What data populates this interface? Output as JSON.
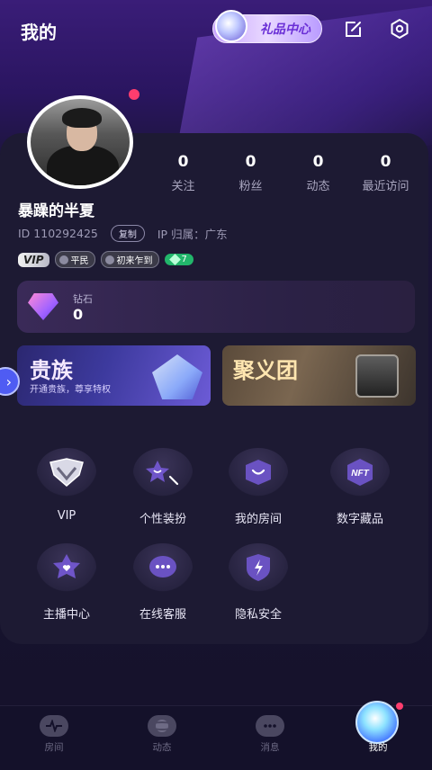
{
  "header": {
    "title": "我的",
    "gift_center": "礼品中心"
  },
  "profile": {
    "username": "暴躁的半夏",
    "id_text": "ID 110292425",
    "copy_label": "复制",
    "ip_text": "IP 归属：广东",
    "stats": [
      {
        "num": "0",
        "label": "关注"
      },
      {
        "num": "0",
        "label": "粉丝"
      },
      {
        "num": "0",
        "label": "动态"
      },
      {
        "num": "0",
        "label": "最近访问"
      }
    ],
    "badges": {
      "vip": "VIP",
      "rank": "平民",
      "tag": "初来乍到",
      "level": "7"
    }
  },
  "wallet": {
    "diamond_label": "钻石",
    "diamond_value": "0"
  },
  "banners": {
    "noble_title": "贵族",
    "noble_subtitle": "开通贵族，尊享特权",
    "group_title": "聚义团"
  },
  "menu": [
    {
      "label": "VIP",
      "icon": "vip-shield-icon"
    },
    {
      "label": "个性装扮",
      "icon": "star-magic-wand-icon"
    },
    {
      "label": "我的房间",
      "icon": "smile-room-icon"
    },
    {
      "label": "数字藏品",
      "icon": "nft-icon"
    },
    {
      "label": "主播中心",
      "icon": "star-heart-icon"
    },
    {
      "label": "在线客服",
      "icon": "chat-bubble-icon"
    },
    {
      "label": "隐私安全",
      "icon": "lightning-shield-icon"
    }
  ],
  "tabbar": [
    {
      "label": "房间",
      "icon": "pulse-icon"
    },
    {
      "label": "动态",
      "icon": "planet-icon"
    },
    {
      "label": "消息",
      "icon": "message-icon"
    },
    {
      "label": "我的",
      "icon": "profile-orb-icon"
    }
  ],
  "colors": {
    "accent": "#4f5cf3",
    "notification": "#ff3d6e",
    "level_badge": "#22b66b"
  }
}
